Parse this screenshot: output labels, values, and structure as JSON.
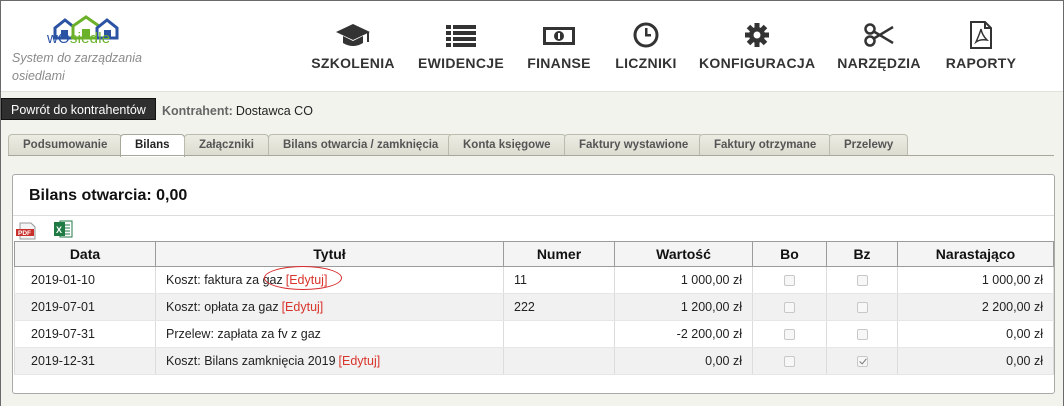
{
  "app": {
    "logo_text_1": "wO",
    "logo_text_2": "siedle",
    "tagline": "System do zarządzania osiedlami"
  },
  "nav": [
    {
      "label": "SZKOLENIA",
      "icon": "graduation-cap-icon"
    },
    {
      "label": "EWIDENCJE",
      "icon": "list-icon"
    },
    {
      "label": "FINANSE",
      "icon": "money-icon"
    },
    {
      "label": "LICZNIKI",
      "icon": "clock-icon"
    },
    {
      "label": "KONFIGURACJA",
      "icon": "gear-icon"
    },
    {
      "label": "NARZĘDZIA",
      "icon": "scissors-icon"
    },
    {
      "label": "RAPORTY",
      "icon": "pdf-file-icon"
    }
  ],
  "subbar": {
    "back_label": "Powrót do kontrahentów",
    "contractor_label": "Kontrahent:",
    "contractor_value": "Dostawca CO"
  },
  "tabs": [
    {
      "label": "Podsumowanie",
      "active": false
    },
    {
      "label": "Bilans",
      "active": true
    },
    {
      "label": "Załączniki",
      "active": false
    },
    {
      "label": "Bilans otwarcia / zamknięcia",
      "active": false
    },
    {
      "label": "Konta księgowe",
      "active": false
    },
    {
      "label": "Faktury wystawione",
      "active": false
    },
    {
      "label": "Faktury otrzymane",
      "active": false
    },
    {
      "label": "Przelewy",
      "active": false
    }
  ],
  "panel": {
    "title": "Bilans otwarcia: 0,00",
    "export_icons": [
      "pdf-export-icon",
      "excel-export-icon"
    ]
  },
  "table": {
    "headers": [
      "Data",
      "Tytuł",
      "Numer",
      "Wartość",
      "Bo",
      "Bz",
      "Narastająco"
    ],
    "rows": [
      {
        "date": "2019-01-10",
        "title": "Koszt: faktura za gaz",
        "edit": "[Edytuj]",
        "number": "11",
        "value": "1 000,00 zł",
        "bo": false,
        "bz": false,
        "cumulative": "1 000,00 zł"
      },
      {
        "date": "2019-07-01",
        "title": "Koszt: opłata za gaz",
        "edit": "[Edytuj]",
        "number": "222",
        "value": "1 200,00 zł",
        "bo": false,
        "bz": false,
        "cumulative": "2 200,00 zł"
      },
      {
        "date": "2019-07-31",
        "title": "Przelew: zapłata za fv z gaz",
        "edit": "",
        "number": "",
        "value": "-2 200,00 zł",
        "bo": false,
        "bz": false,
        "cumulative": "0,00 zł"
      },
      {
        "date": "2019-12-31",
        "title": "Koszt: Bilans zamknięcia 2019",
        "edit": "[Edytuj]",
        "number": "",
        "value": "0,00 zł",
        "bo": false,
        "bz": true,
        "cumulative": "0,00 zł"
      }
    ]
  },
  "colors": {
    "edit_link": "#d9342b",
    "logo_blue": "#2b52a3",
    "logo_green": "#6bb12a"
  }
}
